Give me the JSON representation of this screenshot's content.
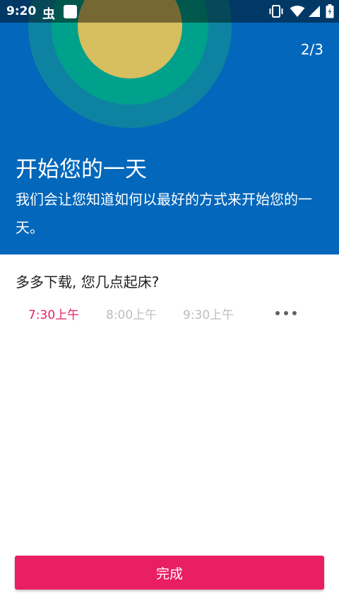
{
  "status_bar": {
    "time": "9:20",
    "bug_glyph": "虫",
    "icons": [
      "bug-icon",
      "square-icon",
      "vibrate-icon",
      "wifi-icon",
      "signal-icon",
      "battery-icon"
    ]
  },
  "hero": {
    "page_counter": "2/3",
    "title": "开始您的一天",
    "description": "我们会让您知道如何以最好的方式来开始您的一天。",
    "colors": {
      "background": "#0367bb",
      "ring_outer": "#0e83a1",
      "ring_middle": "#00a18c",
      "sun": "#d7be5e"
    }
  },
  "question": "多多下载, 您几点起床?",
  "wake_options": [
    {
      "label": "7:30上午",
      "selected": true
    },
    {
      "label": "8:00上午",
      "selected": false
    },
    {
      "label": "9:30上午",
      "selected": false
    }
  ],
  "more_icon": "more-horiz-icon",
  "done_button": {
    "label": "完成",
    "color": "#e91e63"
  }
}
